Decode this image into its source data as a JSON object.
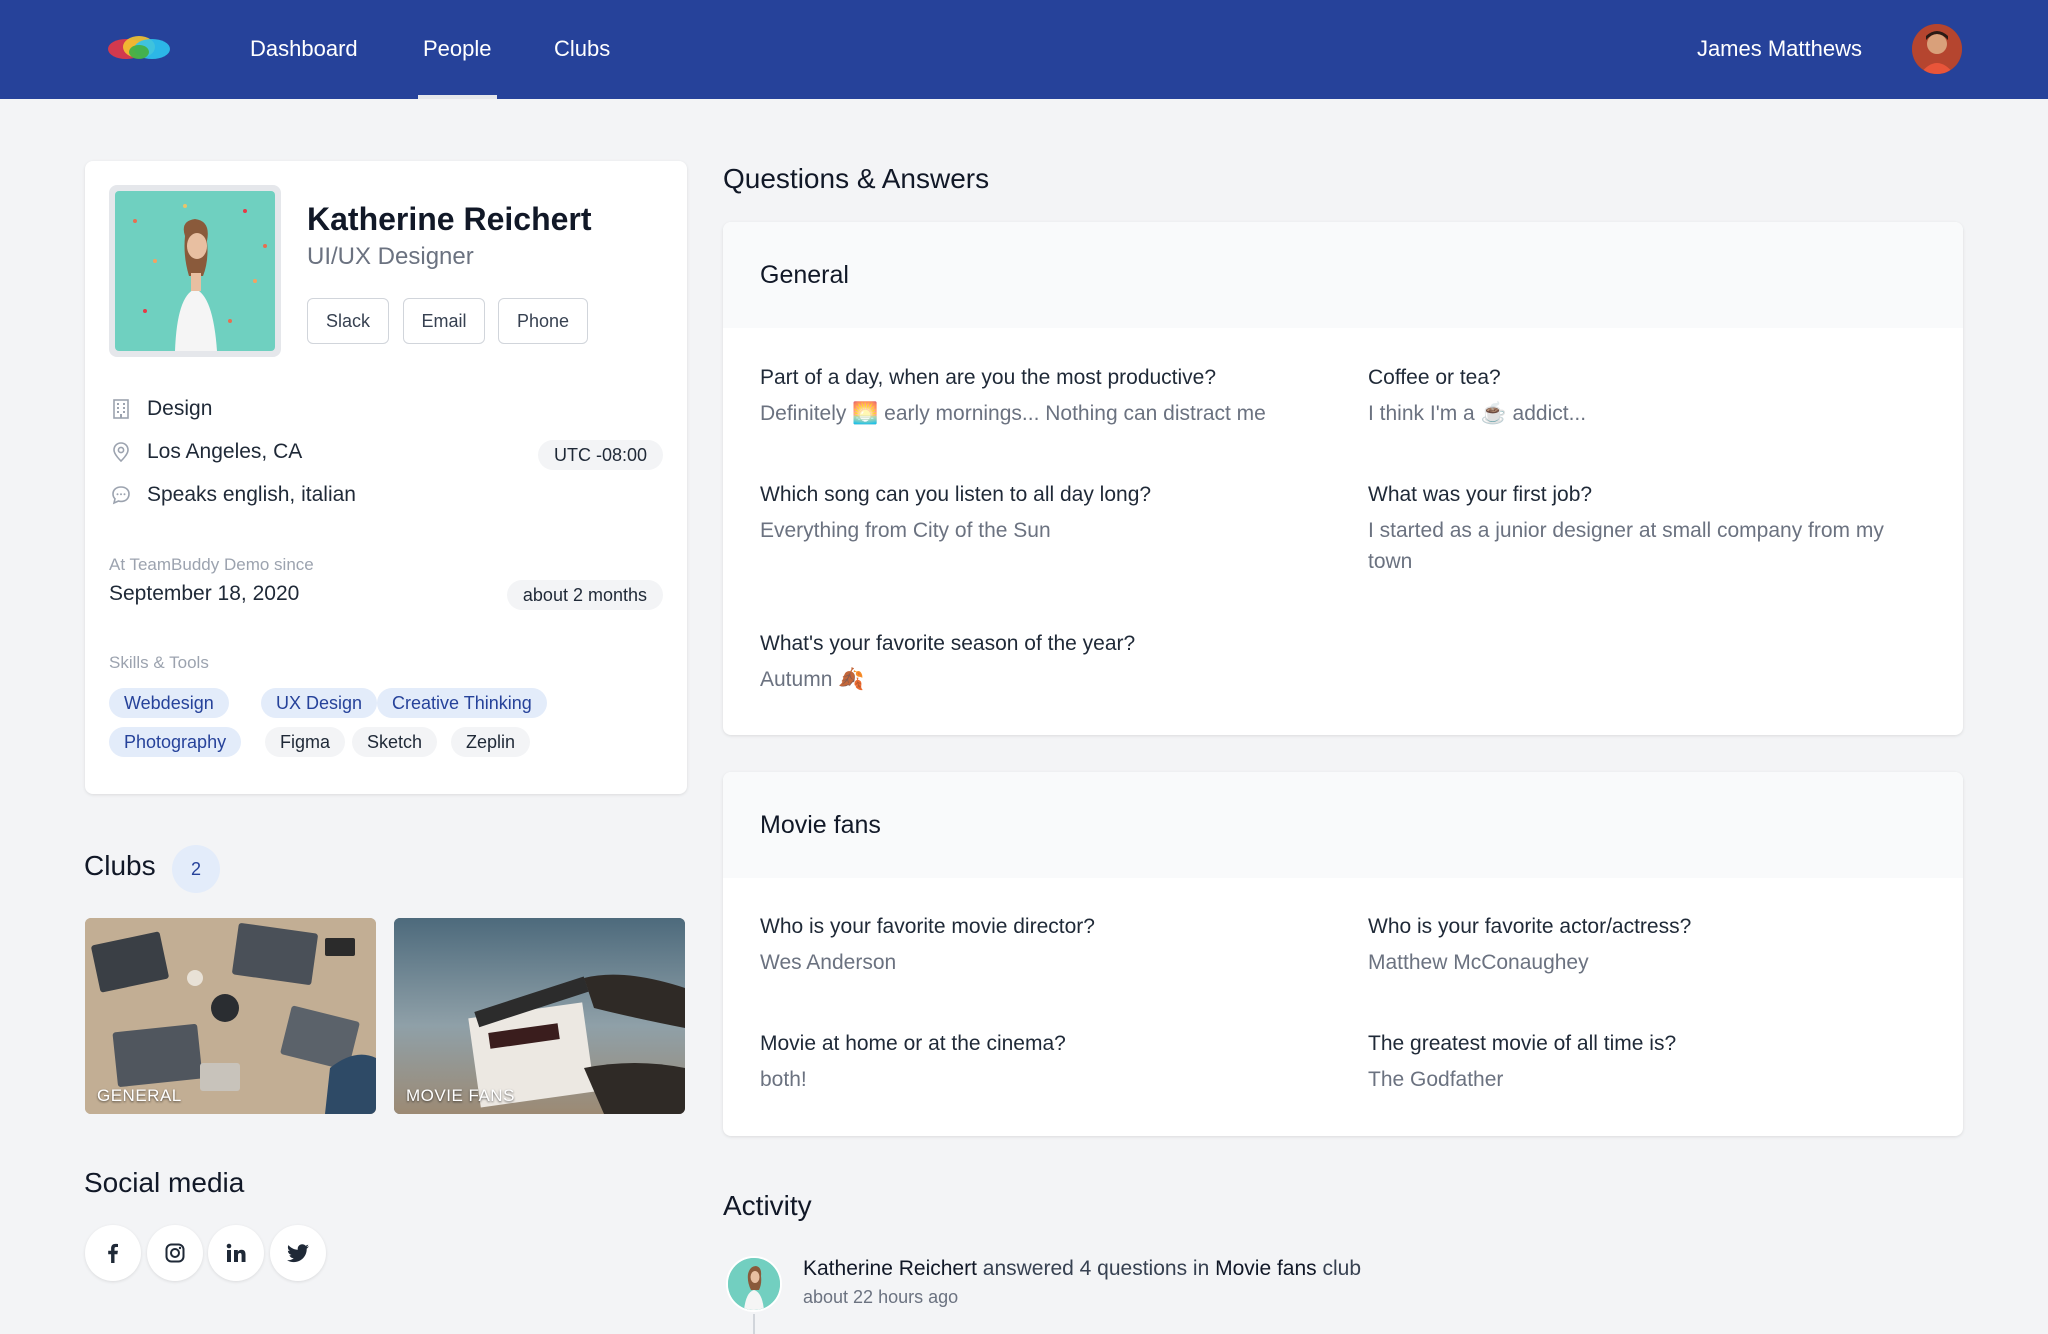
{
  "nav": {
    "items": [
      "Dashboard",
      "People",
      "Clubs"
    ],
    "active": "People",
    "user_name": "James Matthews"
  },
  "profile": {
    "name": "Katherine Reichert",
    "role": "UI/UX Designer",
    "contact_buttons": [
      "Slack",
      "Email",
      "Phone"
    ],
    "department": "Design",
    "location": "Los Angeles, CA",
    "timezone": "UTC -08:00",
    "languages": "Speaks english, italian",
    "since_label": "At TeamBuddy Demo since",
    "since_date": "September 18, 2020",
    "since_duration": "about 2 months",
    "skills_label": "Skills & Tools",
    "skills": [
      "Webdesign",
      "UX Design",
      "Creative Thinking",
      "Photography",
      "Figma",
      "Sketch",
      "Zeplin"
    ]
  },
  "clubs": {
    "title": "Clubs",
    "count": "2",
    "items": [
      "GENERAL",
      "MOVIE FANS"
    ]
  },
  "social": {
    "title": "Social media",
    "icons": [
      "facebook-icon",
      "instagram-icon",
      "linkedin-icon",
      "twitter-icon"
    ]
  },
  "qa": {
    "title": "Questions & Answers",
    "sections": [
      {
        "name": "General",
        "items": [
          {
            "q": "Part of a day, when are you the most productive?",
            "a": "Definitely 🌅 early mornings... Nothing can distract me"
          },
          {
            "q": "Coffee or tea?",
            "a": "I think I'm a ☕ addict..."
          },
          {
            "q": "Which song can you listen to all day long?",
            "a": "Everything from City of the Sun"
          },
          {
            "q": "What was your first job?",
            "a": "I started as a junior designer at small company from my town"
          },
          {
            "q": "What's your favorite season of the year?",
            "a": "Autumn 🍂"
          }
        ]
      },
      {
        "name": "Movie fans",
        "items": [
          {
            "q": "Who is your favorite movie director?",
            "a": "Wes Anderson"
          },
          {
            "q": "Who is your favorite actor/actress?",
            "a": "Matthew McConaughey"
          },
          {
            "q": "Movie at home or at the cinema?",
            "a": "both!"
          },
          {
            "q": "The greatest movie of all time is?",
            "a": "The Godfather"
          }
        ]
      }
    ]
  },
  "activity": {
    "title": "Activity",
    "entry": {
      "actor": "Katherine Reichert",
      "verb": "answered 4 questions in",
      "club": "Movie fans",
      "suffix": "club",
      "time": "about 22 hours ago"
    }
  },
  "colors": {
    "nav_bg": "#26429a",
    "page_bg": "#f3f4f6",
    "skill_highlight_bg": "#e3ecfa",
    "skill_highlight_text": "#26429a"
  }
}
